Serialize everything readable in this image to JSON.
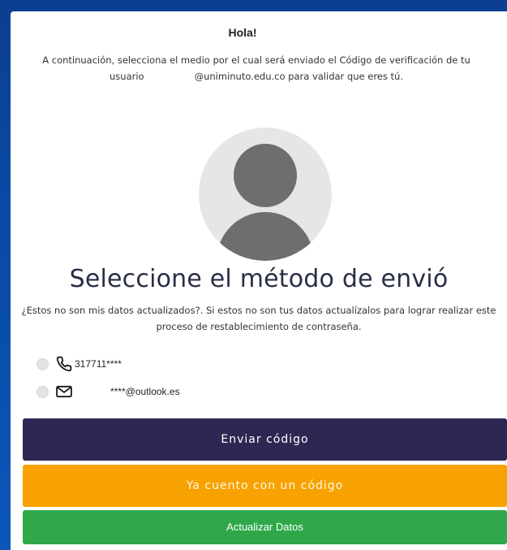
{
  "header": {
    "greeting": "Hola!",
    "intro_line1": "A continuación, selecciona el medio por el cual será enviado el Código de verificación de tu",
    "intro_user_label": "usuario",
    "intro_line2": "@uniminuto.edu.co para validar que eres tú."
  },
  "avatar": {
    "icon": "user-avatar-icon"
  },
  "method": {
    "title": "Seleccione el método de envió",
    "description": "¿Estos no son mis datos actualizados?. Si estos no son tus datos actualízalos para lograr realizar este proceso de restablecimiento de contraseña."
  },
  "options": [
    {
      "icon": "phone-icon",
      "value": "317711****",
      "selected": false
    },
    {
      "icon": "mail-icon",
      "value": "****@outlook.es",
      "selected": false
    }
  ],
  "buttons": {
    "send_label": "Enviar código",
    "have_code_label": "Ya cuento con un código",
    "update_label": "Actualizar Datos"
  },
  "colors": {
    "background": "#0b4aa6",
    "title": "#2a2e45",
    "send_button": "#2d2853",
    "have_code_button": "#f7a200",
    "update_button": "#2fa84a"
  }
}
